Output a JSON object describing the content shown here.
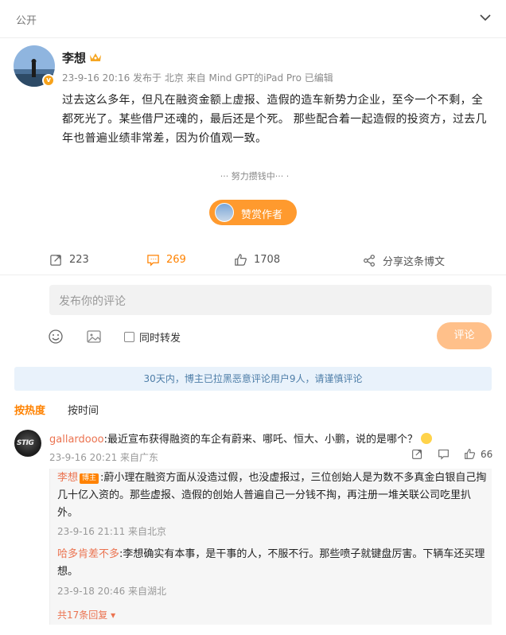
{
  "header": {
    "visibility": "公开"
  },
  "post": {
    "author": "李想",
    "meta": "23-9-16 20:16  发布于 北京  来自 Mind GPT的iPad Pro  已编辑",
    "content": "过去这么多年，但凡在融资金额上虚报、造假的造车新势力企业，至今一个不剩，全都死光了。某些借尸还魂的，最后还是个死。 那些配合着一起造假的投资方，过去几年也普遍业绩非常差，因为价值观一致。",
    "reward_tagline": "··· 努力攒钱中··· ·",
    "reward_button": "赞赏作者",
    "verified_mark": "v"
  },
  "actions": {
    "repost": "223",
    "comment": "269",
    "like": "1708",
    "share": "分享这条博文"
  },
  "composer": {
    "placeholder": "发布你的评论",
    "repost_checkbox": "同时转发",
    "submit": "评论"
  },
  "notice": "30天内，博主已拉黑恶意评论用户9人，请谨慎评论",
  "sort": {
    "hot": "按热度",
    "time": "按时间"
  },
  "comments": [
    {
      "avatar_text": "STIG",
      "user": "gallardooo",
      "text": ":最近宣布获得融资的车企有蔚来、哪吒、恒大、小鹏，说的是哪个？",
      "meta": "23-9-16 20:21  来自广东",
      "likes": "66",
      "replies": [
        {
          "user": "李想",
          "tag": "博主",
          "text": ":蔚小理在融资方面从没造过假，也没虚报过，三位创始人是为数不多真金白银自己掏几十亿入资的。那些虚报、造假的创始人普遍自己一分钱不掏，再注册一堆关联公司吃里扒外。",
          "meta": "23-9-16 21:11  来自北京"
        },
        {
          "user": "哈多肯差不多",
          "text": ":李想确实有本事，是干事的人，不服不行。那些喷子就键盘厉害。下辆车还买理想。",
          "meta": "23-9-18 20:46  来自湖北"
        }
      ],
      "more_replies": "共17条回复 ▾"
    }
  ],
  "colors": {
    "accent": "#ff8200",
    "link": "#eb7350",
    "notice_bg": "#e9f2fb"
  }
}
